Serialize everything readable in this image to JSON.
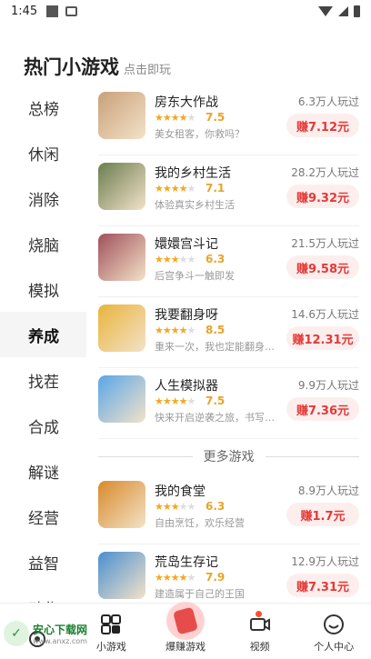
{
  "status": {
    "time": "1:45"
  },
  "header": {
    "title": "热门小游戏",
    "subtitle": "点击即玩"
  },
  "categories": [
    {
      "label": "总榜"
    },
    {
      "label": "休闲"
    },
    {
      "label": "消除"
    },
    {
      "label": "烧脑"
    },
    {
      "label": "模拟"
    },
    {
      "label": "养成"
    },
    {
      "label": "找茬"
    },
    {
      "label": "合成"
    },
    {
      "label": "解谜"
    },
    {
      "label": "经营"
    },
    {
      "label": "益智"
    },
    {
      "label": "动作"
    }
  ],
  "active_category": "养成",
  "games": [
    {
      "name": "房东大作战",
      "rating": "7.5",
      "rating_stars": 3.5,
      "desc": "美女租客，你救吗？",
      "plays": "6.3万人玩过",
      "earn": "赚7.12元",
      "thumb_color": "#c9a07a"
    },
    {
      "name": "我的乡村生活",
      "rating": "7.1",
      "rating_stars": 3.5,
      "desc": "体验真实乡村生活",
      "plays": "28.2万人玩过",
      "earn": "赚9.32元",
      "thumb_color": "#6b7d4f"
    },
    {
      "name": "嬛嬛宫斗记",
      "rating": "6.3",
      "rating_stars": 3,
      "desc": "后宫争斗一触即发",
      "plays": "21.5万人玩过",
      "earn": "赚9.58元",
      "thumb_color": "#a0505a"
    },
    {
      "name": "我要翻身呀",
      "rating": "8.5",
      "rating_stars": 4,
      "desc": "重来一次，我也定能翻身逆袭",
      "plays": "14.6万人玩过",
      "earn": "赚12.31元",
      "thumb_color": "#e9b43c"
    },
    {
      "name": "人生模拟器",
      "rating": "7.5",
      "rating_stars": 3.5,
      "desc": "快来开启逆袭之旅，书写你的人生",
      "plays": "9.9万人玩过",
      "earn": "赚7.36元",
      "thumb_color": "#5aa6e8"
    }
  ],
  "more_label": "更多游戏",
  "more_games": [
    {
      "name": "我的食堂",
      "rating": "6.3",
      "rating_stars": 3,
      "desc": "自由烹饪，欢乐经营",
      "plays": "8.9万人玩过",
      "earn": "赚1.7元",
      "thumb_color": "#d98a2b"
    },
    {
      "name": "荒岛生存记",
      "rating": "7.9",
      "rating_stars": 3.5,
      "desc": "建造属于自己的王国",
      "plays": "12.9万人玩过",
      "earn": "赚7.31元",
      "thumb_color": "#4a8fd1"
    }
  ],
  "bottom_nav": [
    {
      "label": "",
      "icon": "app-home-icon"
    },
    {
      "label": "小游戏",
      "icon": "grid-icon"
    },
    {
      "label": "爆赚游戏",
      "icon": "red-packet-icon"
    },
    {
      "label": "视频",
      "icon": "video-icon"
    },
    {
      "label": "个人中心",
      "icon": "smile-icon"
    }
  ],
  "watermark": {
    "main": "安心下载网",
    "sub": "www.anxz.com"
  },
  "colors": {
    "accent": "#e53935",
    "earn_bg": "#fdeeee",
    "star": "#f5a623"
  }
}
